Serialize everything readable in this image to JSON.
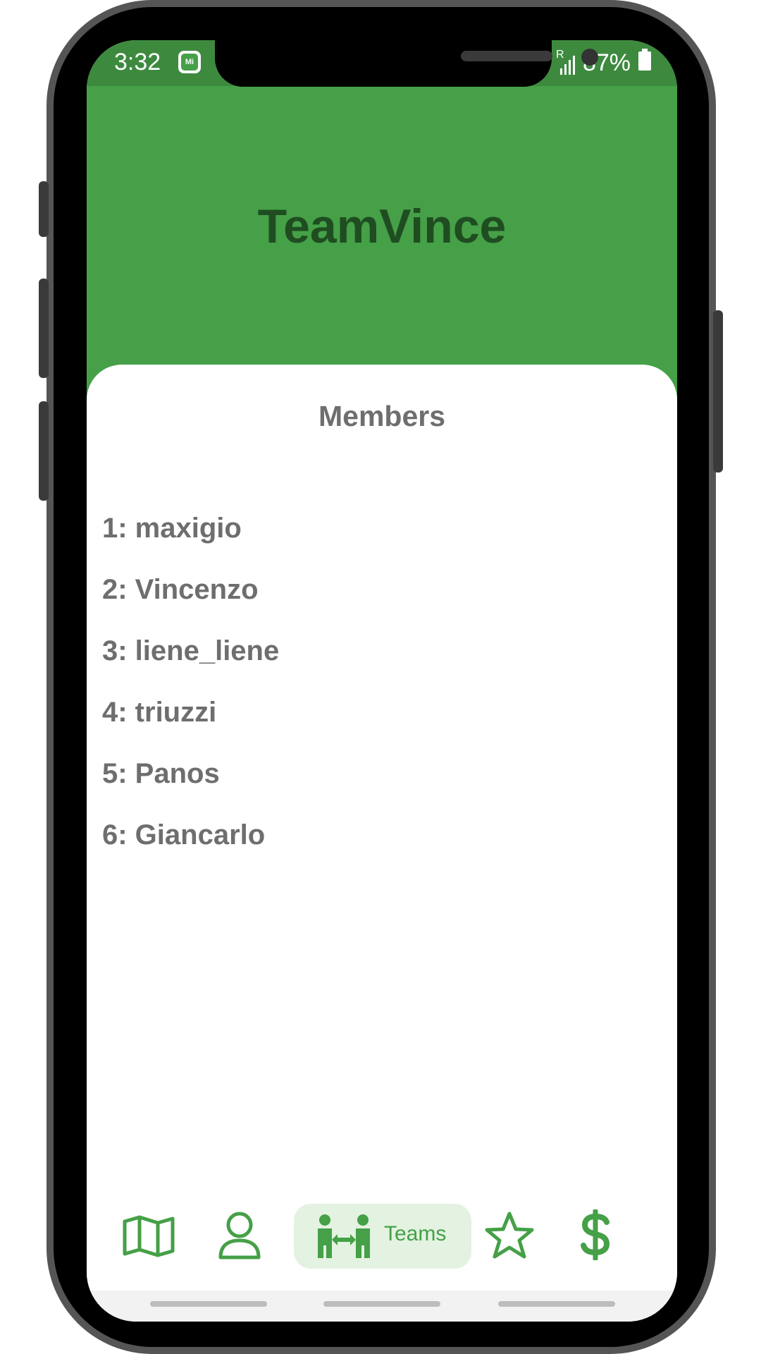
{
  "status_bar": {
    "time": "3:32",
    "app_icon_text": "Mi",
    "signal_label": "R",
    "battery": "87%"
  },
  "header": {
    "team_name": "TeamVince"
  },
  "members": {
    "heading": "Members",
    "items": [
      "1: maxigio",
      "2: Vincenzo",
      "3: liene_liene",
      "4: triuzzi",
      "5: Panos",
      "6: Giancarlo"
    ]
  },
  "nav": {
    "items": [
      {
        "icon": "map-icon"
      },
      {
        "icon": "person-icon"
      },
      {
        "icon": "teams-icon",
        "label": "Teams"
      },
      {
        "icon": "star-icon"
      },
      {
        "icon": "dollar-icon"
      }
    ],
    "active_label": "Teams"
  },
  "colors": {
    "primary": "#45a047",
    "status_bar": "#3d8a3f",
    "title_text": "#1f4d21",
    "body_text": "#6e6e6e",
    "nav_active_bg": "#e3f2e1"
  }
}
